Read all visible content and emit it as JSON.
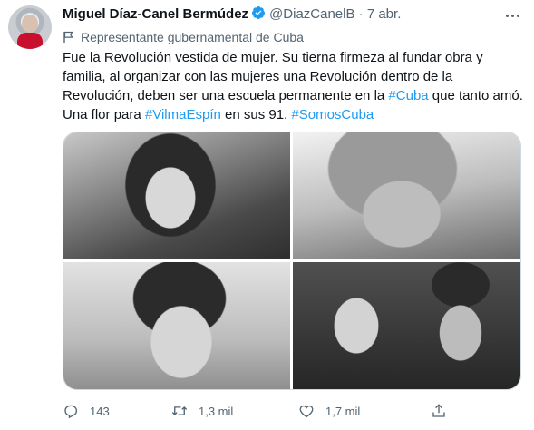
{
  "author": {
    "name": "Miguel Díaz-Canel Bermúdez",
    "handle": "@DiazCanelB",
    "separator": "·",
    "date": "7 abr.",
    "verified": true,
    "avatar_icon": "profile-photo"
  },
  "account_label": {
    "icon": "flag-icon",
    "text": "Representante gubernamental de Cuba"
  },
  "tweet": {
    "line1": "Fue la Revolución vestida de mujer. Su tierna firmeza al fundar obra y",
    "line2": "familia, al organizar con las mujeres una Revolución dentro de la",
    "line3_pre": "Revolución, deben ser una escuela permanente en la ",
    "line3_hashtag": "#Cuba",
    "line3_post": " que tanto amó.",
    "line4_pre": "Una flor para ",
    "line4_hashtag1": "#VilmaEspín",
    "line4_mid": " en sus 91. ",
    "line4_hashtag2": "#SomosCuba"
  },
  "media": {
    "photos": [
      "photo-1-young-woman-smiling",
      "photo-2-older-woman-glasses",
      "photo-3-woman-portrait",
      "photo-4-couple-portrait"
    ]
  },
  "actions": {
    "reply_count": "143",
    "retweet_count": "1,3 mil",
    "like_count": "1,7 mil"
  },
  "colors": {
    "accent": "#1d9bf0",
    "secondary_text": "#536471",
    "primary_text": "#0f1419",
    "border": "#cfd9de"
  }
}
